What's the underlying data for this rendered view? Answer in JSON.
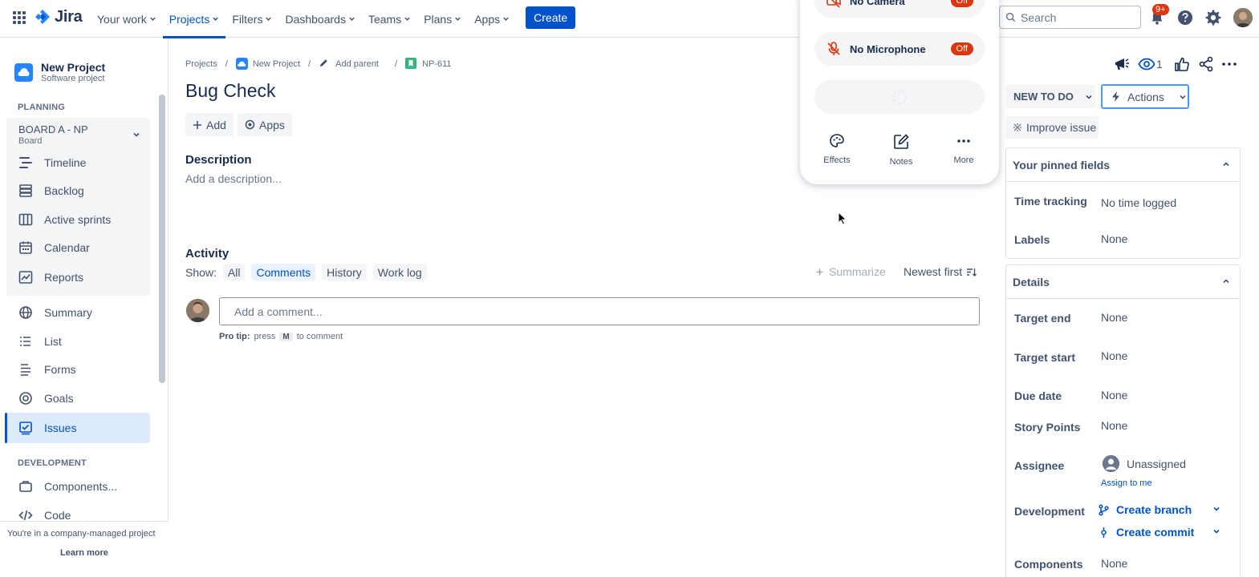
{
  "topnav": {
    "logo_text": "Jira",
    "items": [
      {
        "label": "Your work"
      },
      {
        "label": "Projects"
      },
      {
        "label": "Filters"
      },
      {
        "label": "Dashboards"
      },
      {
        "label": "Teams"
      },
      {
        "label": "Plans"
      },
      {
        "label": "Apps"
      }
    ],
    "active_item": "Projects",
    "create_label": "Create",
    "search_placeholder": "Search",
    "notification_badge": "9+",
    "brand_color": "#0052cc"
  },
  "sidebar": {
    "project_name": "New Project",
    "project_type": "Software project",
    "planning_label": "PLANNING",
    "board_title": "BOARD A - NP",
    "board_subtitle": "Board",
    "board_items": [
      {
        "label": "Timeline",
        "icon": "timeline-icon"
      },
      {
        "label": "Backlog",
        "icon": "backlog-icon"
      },
      {
        "label": "Active sprints",
        "icon": "active-sprints-icon"
      },
      {
        "label": "Calendar",
        "icon": "calendar-icon"
      },
      {
        "label": "Reports",
        "icon": "reports-icon"
      }
    ],
    "items": [
      {
        "label": "Summary",
        "icon": "globe-icon"
      },
      {
        "label": "List",
        "icon": "list-icon"
      },
      {
        "label": "Forms",
        "icon": "forms-icon"
      },
      {
        "label": "Goals",
        "icon": "goals-icon"
      },
      {
        "label": "Issues",
        "icon": "issues-icon",
        "selected": true
      }
    ],
    "development_label": "DEVELOPMENT",
    "dev_items": [
      {
        "label": "Components...",
        "icon": "components-icon"
      },
      {
        "label": "Code",
        "icon": "code-icon"
      }
    ],
    "footer_text": "You're in a company-managed project",
    "footer_link": "Learn more"
  },
  "issue": {
    "breadcrumb": {
      "projects": "Projects",
      "project": "New Project",
      "add_parent": "Add parent",
      "key": "NP-611"
    },
    "title": "Bug Check",
    "add_label": "Add",
    "apps_label": "Apps",
    "description_heading": "Description",
    "description_placeholder": "Add a description...",
    "activity_heading": "Activity",
    "show_label": "Show:",
    "filters": [
      "All",
      "Comments",
      "History",
      "Work log"
    ],
    "active_filter": "Comments",
    "summarize_label": "Summarize",
    "sort_label": "Newest first",
    "comment_placeholder": "Add a comment...",
    "protip_prefix": "Pro tip:",
    "protip_press": "press",
    "protip_key": "M",
    "protip_suffix": "to comment"
  },
  "video_popup": {
    "camera_label": "No Camera",
    "camera_state": "Off",
    "mic_label": "No Microphone",
    "mic_state": "Off",
    "tools": [
      {
        "label": "Effects",
        "icon": "effects-icon"
      },
      {
        "label": "Notes",
        "icon": "notes-icon"
      },
      {
        "label": "More",
        "icon": "more-icon"
      }
    ]
  },
  "right": {
    "watch_count": "1",
    "status_label": "NEW TO DO",
    "actions_label": "Actions",
    "improve_label": "Improve issue",
    "pinned_heading": "Your pinned fields",
    "pinned_fields": [
      {
        "label": "Time tracking",
        "value": "No time logged"
      },
      {
        "label": "Labels",
        "value": "None"
      }
    ],
    "details_heading": "Details",
    "details_fields": [
      {
        "label": "Target end",
        "value": "None"
      },
      {
        "label": "Target start",
        "value": "None"
      },
      {
        "label": "Due date",
        "value": "None"
      },
      {
        "label": "Story Points",
        "value": "None"
      },
      {
        "label": "Assignee",
        "value": "Unassigned"
      },
      {
        "label": "Development",
        "value": ""
      },
      {
        "label": "Components",
        "value": "None"
      }
    ],
    "assign_to_me": "Assign to me",
    "create_branch": "Create branch",
    "create_commit": "Create commit"
  }
}
